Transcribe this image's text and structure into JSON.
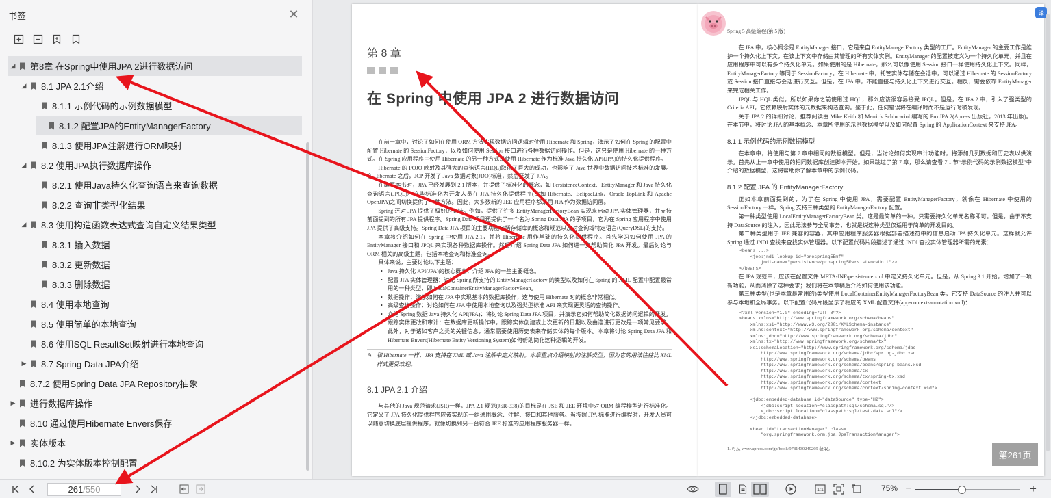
{
  "sidebar": {
    "title": "书签",
    "toc": [
      {
        "label": "第8章 在Spring中使用JPA 2进行数据访问",
        "level": 0,
        "arrow": "expanded",
        "selected": true
      },
      {
        "label": "8.1 JPA 2.1介绍",
        "level": 1,
        "arrow": "expanded",
        "selected": false
      },
      {
        "label": "8.1.1 示例代码的示例数据模型",
        "level": 2,
        "arrow": "none",
        "selected": false
      },
      {
        "label": "8.1.2 配置JPA的EntityManagerFactory",
        "level": 2,
        "arrow": "none",
        "selected": true
      },
      {
        "label": "8.1.3 使用JPA注解进行ORM映射",
        "level": 2,
        "arrow": "none",
        "selected": false
      },
      {
        "label": "8.2 使用JPA执行数据库操作",
        "level": 1,
        "arrow": "expanded",
        "selected": false
      },
      {
        "label": "8.2.1 使用Java持久化查询语言来查询数据",
        "level": 2,
        "arrow": "none",
        "selected": false
      },
      {
        "label": "8.2.2 查询非类型化结果",
        "level": 2,
        "arrow": "none",
        "selected": false
      },
      {
        "label": "8.3 使用构造函数表达式查询自定义结果类型",
        "level": 1,
        "arrow": "expanded",
        "selected": false
      },
      {
        "label": "8.3.1 插入数据",
        "level": 2,
        "arrow": "none",
        "selected": false
      },
      {
        "label": "8.3.2 更新数据",
        "level": 2,
        "arrow": "none",
        "selected": false
      },
      {
        "label": "8.3.3 删除数据",
        "level": 2,
        "arrow": "none",
        "selected": false
      },
      {
        "label": "8.4 使用本地查询",
        "level": 1,
        "arrow": "none",
        "selected": false
      },
      {
        "label": "8.5 使用简单的本地查询",
        "level": 1,
        "arrow": "none",
        "selected": false
      },
      {
        "label": "8.6 使用SQL ResultSet映射进行本地查询",
        "level": 1,
        "arrow": "none",
        "selected": false
      },
      {
        "label": "8.7 Spring Data JPA介绍",
        "level": 1,
        "arrow": "collapsed",
        "selected": false
      },
      {
        "label": "8.7.2 使用Spring Data JPA Repository抽象",
        "level": 0,
        "arrow": "none",
        "selected": false
      },
      {
        "label": "进行数据库操作",
        "level": 0,
        "arrow": "collapsed",
        "selected": false
      },
      {
        "label": "8.10 通过使用Hibernate Envers保存",
        "level": 0,
        "arrow": "none",
        "selected": false
      },
      {
        "label": "实体版本",
        "level": 0,
        "arrow": "collapsed",
        "selected": false
      },
      {
        "label": "8.10.2 为实体版本控制配置",
        "level": 0,
        "arrow": "none",
        "selected": false
      }
    ]
  },
  "left_page": {
    "chapter_num": "第 8 章",
    "chapter_title": "在 Spring 中使用 JPA 2 进行数据访问",
    "paragraphs": [
      "在前一章中，讨论了如何在使用 ORM 方法实现数据访问逻辑时使用 Hibernate 和 Spring，演示了如何在 Spring 的配置中配置 Hibernate 的 SessionFactory，以及如何使用 Session 接口进行各种数据访问操作。但是，这只是使用 Hibernate 的一种方式。在 Spring 应用程序中使用 Hibernate 的另一种方式是使用 Hibernate 作为标准 Java 持久化 API(JPA)的持久化提供程序。",
      "Hibernate 的 POJO 映射及其强大的查询语言(HQL)取得了巨大的成功，也影响了 Java 世界中数据访问技术标准的发展。在 Hibernate 之后，JCP 开发了 Java 数据对象(JDO)标准，然后开发了 JPA。",
      "在编写本书时，JPA 已经发展到 2.1 版本，并提供了标准化的概念，如 PersistenceContext、EntityManager 和 Java 持久化查询语言(JPQL)。这些标准化为开发人员在 JPA 持久化提供程序(比如 Hibernate、EclipseLink、Oracle TopLink 和 Apache OpenJPA)之间切换提供了一种方法。因此，大多数新的 JEE 应用程序都采用 JPA 作为数据访问层。",
      "Spring 还对 JPA 提供了极好的支持。例如，提供了许多 EntityManagerFactoryBean 实现来启动 JPA 实体管理器，并支持前面提到的所有 JPA 提供程序。Spring Data 项目还提供了一个名为 Spring Data JPA 的子项目，它为在 Spring 应用程序中使用 JPA 提供了高级支持。Spring Data JPA 项目的主要功能包括存储库的概念和规范以及对查询域特定语言(QueryDSL)的支持。",
      "本章将介绍如何在 Spring 中使用 JPA 2.1，并将 Hibernate 用作基础的持久化提供程序。首先学习如何使用 JPA 的 EntityManager 接口和 JPQL 来实现各种数据库操作。然后介绍 Spring Data JPA 如何进一步帮助简化 JPA 开发。最后讨论与 ORM 相关的高级主题，包括本地查询和标准查询。",
      "具体来说，主要讨论以下主题："
    ],
    "bullets": [
      "Java 持久化 API(JPA)的核心概念：介绍 JPA 的一些主要概念。",
      "配置 JPA 实体管理器：讨论 Spring 所支持的 EntityManagerFactory 的类型以及如何在 Spring 的 XML 配置中配置最常用的一种类型，即 LocalContainerEntityManagerFactoryBean。",
      "数据操作：演示如何在 JPA 中实现基本的数据库操作，这与使用 Hibernate 时的概念非常相似。",
      "高级查询操作：讨论如何在 JPA 中使用本地查询以及强类型标准 API 来实现更灵活的查询操作。",
      "介绍 Spring 数据 Java 持久化 API(JPA)：将讨论 Spring Data JPA 项目，并演示它如何帮助简化数据访问逻辑的开发。",
      "跟踪实体更改和审计：在数据库更新操作中，跟踪实体创建或上次更新的日期以及由谁进行更改是一项常见要求。此外，对于诸如客户之类的关键信息，通常需要使用历史表来存储实体的每个版本。本章将讨论 Spring Data JPA 和 Hibernate Envers(Hibernate Entity Versioning System)如何帮助简化这种逻辑的开发。"
    ],
    "note": "和 Hibernate 一样，JPA 支持在 XML 或 Java 注解中定义映射。本章重点介绍映射的注解类型，因为它的用法往往比 XML 样式更受欢迎。",
    "section_heading": "8.1   JPA 2.1 介绍",
    "section_para": "与其他的 Java 规范请求(JSR)一样，JPA 2.1 规范(JSR-338)的目标是在 JSE 和 JEE 环境中对 ORM 编程模型进行标准化。它定义了 JPA 持久化提供程序应该实现的一组通用概念、注解、接口和其他服务。当按照 JPA 标准进行编程时，开发人员可以随意切换底层提供程序，就像切换到另一台符合 JEE 标准的应用程序服务器一样。"
  },
  "right_page": {
    "running_head": "Spring 5 高级编程(第 5 版)",
    "paragraphs": [
      "在 JPA 中，核心概念是 EntityManager 接口，它是来自 EntityManagerFactory 类型的工厂。EntityManager 的主要工作是维护一个持久化上下文，在该上下文中存储由其管理的所有实体实例。EntityManager 的配置被定义为一个持久化单元，并且在应用程序中可以有多个持久化单元。如果使用的是 Hibernate，那么可以像使用 Session 接口一样使用持久化上下文。同样，EntityManagerFactory 等同于 SessionFactory。在 Hibernate 中，托管实体存储在会话中，可以通过 Hibernate 的 SessionFactory 或 Session 接口直接与会话进行交互。但是，在 JPA 中，不能直接与持久化上下文进行交互。相反，需要依靠 EntityManager 来完成相关工作。",
      "JPQL 与 HQL 类似，所以如果你之前使用过 HQL，那么应该很容易接受 JPQL。但是，在 JPA 2 中，引入了强类型的 Criteria API，它依赖映射实体的元数据来构造查询。鉴于此，任何错误将在编译时而不是运行时被发现。",
      "关于 JPA 2 的详细讨论，推荐阅读由 Mike Keith 和 Merrick Schincariol 编写的 Pro JPA 2(Apress 出版社，2013 年出版)。在本节中，将讨论 JPA 的基本概念、本章所使用的示例数据模型以及如何配置 Spring 的 ApplicationContext 来支持 JPA。"
    ],
    "h1": "8.1.1   示例代码的示例数据模型",
    "p_811": "在本章中，将使用与第 7 章中相同的数据模型。但是，当讨论如何实现审计功能时，将添加几列数据和历史表以供演示。首先从上一章中使用的相同数据库创建脚本开始。如果跳过了第 7 章，那么请查看 7.1 节“示例代码的示例数据模型”中介绍的数据模型，这将帮助你了解本章中的示例代码。",
    "h2": "8.1.2   配置 JPA 的 EntityManagerFactory",
    "p_812": [
      "正如本章前面提到的，为了在 Spring 中使用 JPA，需要配置 EntityManagerFactory，就像在 Hibernate 中使用的 SessionFactory 一样。Spring 支持三种类型的 EntityManagerFactory 配置。",
      "第一种类型使用 LocalEntityManagerFactoryBean 类。这是最简单的一种，只需要持久化单元名称即可。但是，由于不支持 DataSource 的注入，因此无法参与全局事务，也就是说这种类型仅适用于简单的开发目的。",
      "第二种类型用于 JEE 兼容的容器，其中应用程序服务器根据部署描述符中的信息启动 JPA 持久化单元。这样就允许 Spring 通过 JNDI 查找来查找实体管理器。以下配置代码片段描述了通过 JNDI 查找实体管理器所需的元素："
    ],
    "code1": "<beans ...>\n    <jee:jndi-lookup id=\"prospring5Emf\"\n        jndi-name=\"persistence/prospring5PersistenceUnit\"/>\n</beans>",
    "p_after1": [
      "在 JPA 规范中，应该在配置文件 META-INF/persistence.xml 中定义持久化单元。但是，从 Spring 3.1 开始，增加了一项新功能，从而消除了这种要求；我们将在本章稍后介绍如何使用该功能。",
      "第三种类型(也是本章最常用的)类型使用 LocalContainerEntityManagerFactoryBean 类，它支持 DataSource 的注入并可以参与本地和全局事务。以下配置代码片段显示了相应的 XML 配置文件(app-context-annotation.xml)："
    ],
    "code2": "<?xml version=\"1.0\" encoding=\"UTF-8\"?>\n<beans xmlns=\"http://www.springframework.org/schema/beans\"\n    xmlns:xsi=\"http://www.w3.org/2001/XMLSchema-instance\"\n    xmlns:context=\"http://www.springframework.org/schema/context\"\n    xmlns:jdbc=\"http://www.springframework.org/schema/jdbc\"\n    xmlns:tx=\"http://www.springframework.org/schema/tx\"\n    xsi:schemaLocation=\"http://www.springframework.org/schema/jdbc\n        http://www.springframework.org/schema/jdbc/spring-jdbc.xsd\n        http://www.springframework.org/schema/beans\n        http://www.springframework.org/schema/beans/spring-beans.xsd\n        http://www.springframework.org/schema/tx\n        http://www.springframework.org/schema/tx/spring-tx.xsd\n        http://www.springframework.org/schema/context\n        http://www.springframework.org/schema/context/spring-context.xsd\">\n\n    <jdbc:embedded-database id=\"dataSource\" type=\"H2\">\n        <jdbc:script location=\"classpath:sql/schema.sql\"/>\n        <jdbc:script location=\"classpath:sql/test-data.sql\"/>\n    </jdbc:embedded-database>\n\n    <bean id=\"transactionManager\" class=\n        \"org.springframework.orm.jpa.JpaTransactionManager\">",
    "footnote": "1. 可从 www.apress.com/gp/book/9781430249269 获取。"
  },
  "badge": "第261页",
  "status": {
    "page_current": "261",
    "page_total": "/550",
    "zoom": "75%",
    "zoom_fraction": 0.45
  },
  "translate_label": "译"
}
